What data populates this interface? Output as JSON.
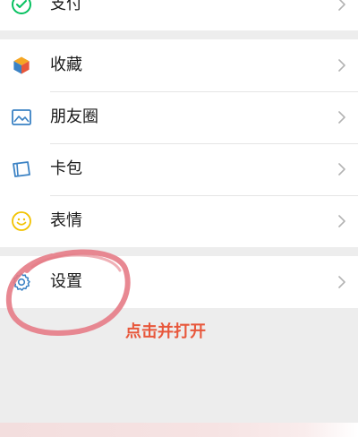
{
  "menu_top": {
    "items": [
      {
        "label": "支付",
        "icon": "wechat-pay-icon"
      }
    ]
  },
  "menu_main": {
    "items": [
      {
        "label": "收藏",
        "icon": "favorites-cube-icon"
      },
      {
        "label": "朋友圈",
        "icon": "moments-photo-icon"
      },
      {
        "label": "卡包",
        "icon": "card-wallet-icon"
      },
      {
        "label": "表情",
        "icon": "emoji-smiley-icon"
      }
    ]
  },
  "menu_settings": {
    "items": [
      {
        "label": "设置",
        "icon": "gear-icon"
      }
    ]
  },
  "annotation": {
    "text": "点击并打开"
  },
  "colors": {
    "background": "#ededed",
    "row_bg": "#ffffff",
    "accent_red": "#e8573b",
    "circle_stroke": "#e57b86",
    "wechat_green": "#07c160",
    "blue_icon": "#3b82c4"
  }
}
